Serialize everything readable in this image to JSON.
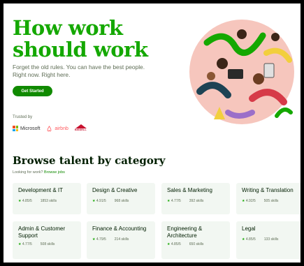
{
  "hero": {
    "title": "How work should work",
    "subtitle": "Forget the old rules. You can have the best people. Right now. Right here.",
    "cta_label": "Get Started"
  },
  "trusted": {
    "label": "Trusted by",
    "logos": [
      "Microsoft",
      "airbnb",
      "BISSELL"
    ]
  },
  "browse": {
    "title": "Browse talent by category",
    "sub_prefix": "Looking for work?",
    "sub_link": "Browse jobs",
    "categories": [
      {
        "name": "Development & IT",
        "rating": "4.85/5",
        "skills": "1853 skills"
      },
      {
        "name": "Design & Creative",
        "rating": "4.91/5",
        "skills": "968 skills"
      },
      {
        "name": "Sales & Marketing",
        "rating": "4.77/5",
        "skills": "392 skills"
      },
      {
        "name": "Writing & Translation",
        "rating": "4.92/5",
        "skills": "505 skills"
      },
      {
        "name": "Admin & Customer Support",
        "rating": "4.77/5",
        "skills": "508 skills"
      },
      {
        "name": "Finance & Accounting",
        "rating": "4.79/5",
        "skills": "214 skills"
      },
      {
        "name": "Engineering & Architecture",
        "rating": "4.85/5",
        "skills": "650 skills"
      },
      {
        "name": "Legal",
        "rating": "4.85/5",
        "skills": "133 skills"
      }
    ]
  },
  "colors": {
    "brand_green": "#14a800",
    "button_green": "#108a00",
    "card_bg": "#f2f7f2"
  }
}
